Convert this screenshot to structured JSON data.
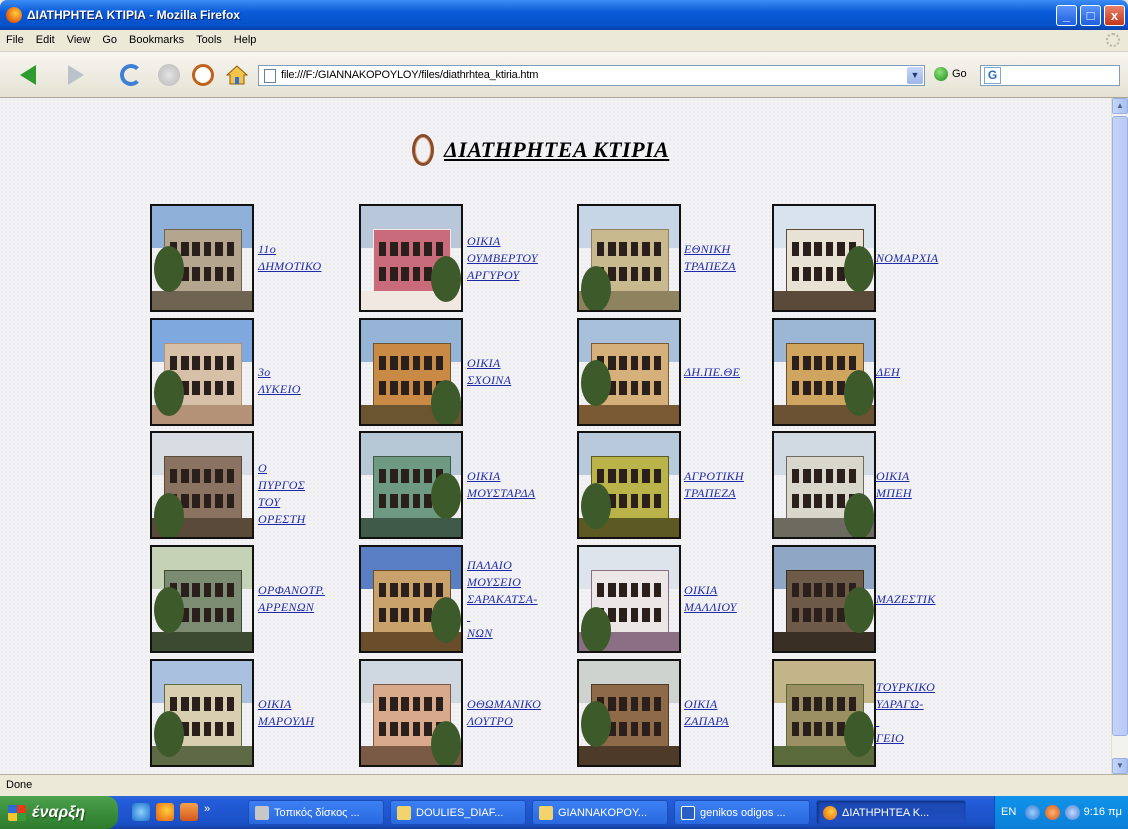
{
  "window": {
    "title": "ΔΙΑΤΗΡΗΤΕΑ ΚΤΙΡΙΑ - Mozilla Firefox",
    "minimize": "_",
    "maximize": "□",
    "close": "x"
  },
  "menu": {
    "items": [
      "File",
      "Edit",
      "View",
      "Go",
      "Bookmarks",
      "Tools",
      "Help"
    ]
  },
  "toolbar": {
    "url": "file:///F:/GIANNAKOPOYLOY/files/diathrhtea_ktiria.htm",
    "go_label": "Go",
    "search_engine_glyph": "G",
    "icons": [
      "back-icon",
      "forward-icon",
      "reload-icon",
      "stop-icon",
      "history-icon",
      "home-icon",
      "page-icon",
      "dropdown-icon",
      "go-icon",
      "google-icon"
    ]
  },
  "page": {
    "heading": "ΔΙΑΤΗΡΗΤΕΑ ΚΤΙΡΙΑ",
    "buildings": [
      [
        "11ο",
        "ΔΗΜΟΤΙΚΟ"
      ],
      [
        "ΟΙΚΙΑ",
        "ΟΥΜΒΕΡΤΟΥ",
        "ΑΡΓΥΡΟΥ"
      ],
      [
        "ΕΘΝΙΚΗ",
        "ΤΡΑΠΕΖΑ"
      ],
      [
        "ΝΟΜΑΡΧΙΑ"
      ],
      [
        "3ο ΛΥΚΕΙΟ"
      ],
      [
        "ΟΙΚΙΑ",
        "ΣΧΟΙΝΑ"
      ],
      [
        "ΔΗ.ΠΕ.ΘΕ"
      ],
      [
        "ΔΕΗ"
      ],
      [
        "Ο ΠΥΡΓΟΣ",
        "ΤΟΥ",
        "ΟΡΕΣΤΗ"
      ],
      [
        "ΟΙΚΙΑ",
        "ΜΟΥΣΤΑΡΔΑ"
      ],
      [
        "ΑΓΡΟΤΙΚΗ",
        "ΤΡΑΠΕΖΑ"
      ],
      [
        "ΟΙΚΙΑ",
        "ΜΠΕΗ"
      ],
      [
        "ΟΡΦΑΝΟΤΡ.",
        "ΑΡΡΕΝΩΝ"
      ],
      [
        "ΠΑΛΑΙΟ",
        "ΜΟΥΣΕΙΟ",
        "ΣΑΡΑΚΑΤΣΑ-",
        "",
        "ΝΩΝ"
      ],
      [
        "ΟΙΚΙΑ",
        "ΜΑΛΛΙΟΥ"
      ],
      [
        "ΜΑΖΕΣΤΙΚ"
      ],
      [
        "ΟΙΚΙΑ",
        "ΜΑΡΟΥΛΗ"
      ],
      [
        "ΟΘΩΜΑΝΙΚΟ",
        "ΛΟΥΤΡΟ"
      ],
      [
        "ΟΙΚΙΑ",
        "ΖΑΠΑΡΑ"
      ],
      [
        "ΤΟΥΡΚΙΚΟ",
        "ΥΔΡΑΓΩ-",
        "",
        "ΓΕΙΟ"
      ]
    ],
    "photo_colors": [
      {
        "sky": "#8fb0d8",
        "bld": "#b3a58e",
        "accent": "#6f6452"
      },
      {
        "sky": "#b9c7da",
        "bld": "#c96b7a",
        "accent": "#f1e8e2"
      },
      {
        "sky": "#c7d6e6",
        "bld": "#c9b98e",
        "accent": "#8f835f"
      },
      {
        "sky": "#d9e3ee",
        "bld": "#e8e2d4",
        "accent": "#5b4a3a"
      },
      {
        "sky": "#7fa8df",
        "bld": "#d7c0a8",
        "accent": "#b39277"
      },
      {
        "sky": "#96b4d6",
        "bld": "#c98a46",
        "accent": "#6b5530"
      },
      {
        "sky": "#a8c0da",
        "bld": "#d6b07a",
        "accent": "#7a5a35"
      },
      {
        "sky": "#9cb7d6",
        "bld": "#cfa560",
        "accent": "#6a5233"
      },
      {
        "sky": "#d8dde3",
        "bld": "#8a7461",
        "accent": "#5a4a3a"
      },
      {
        "sky": "#b6c7d6",
        "bld": "#6f9a82",
        "accent": "#3f5a48"
      },
      {
        "sky": "#b8c9dc",
        "bld": "#b9b34a",
        "accent": "#5c5a22"
      },
      {
        "sky": "#d1d9e2",
        "bld": "#d9d6cc",
        "accent": "#6d6a60"
      },
      {
        "sky": "#c5d2b5",
        "bld": "#7c8c72",
        "accent": "#3b4a30"
      },
      {
        "sky": "#5a7ec4",
        "bld": "#c8a26a",
        "accent": "#6a4d2a"
      },
      {
        "sky": "#dde4ec",
        "bld": "#ece6e6",
        "accent": "#8a6f85"
      },
      {
        "sky": "#8fa6c4",
        "bld": "#6d5a48",
        "accent": "#3a2f25"
      },
      {
        "sky": "#a9c1de",
        "bld": "#d7cfb0",
        "accent": "#5e6a45"
      },
      {
        "sky": "#cfd8e1",
        "bld": "#d8a98a",
        "accent": "#7a5a45"
      },
      {
        "sky": "#cfd3cf",
        "bld": "#8f6a48",
        "accent": "#4d3a28"
      },
      {
        "sky": "#c4b48a",
        "bld": "#9a8f62",
        "accent": "#5a6a3a"
      }
    ]
  },
  "status": {
    "text": "Done"
  },
  "taskbar": {
    "start_label": "έναρξη",
    "tasks": [
      "Τοπικός δίσκος ...",
      "DOULIES_DIAF...",
      "GIANNAKOPOY...",
      "genikos odigos ...",
      "ΔΙΑΤΗΡΗΤΕΑ Κ..."
    ],
    "language": "EN",
    "clock": "9:16 πμ",
    "overflow": "»"
  },
  "colors": {
    "link": "#1f2aa8",
    "titlebar": "#0a5bd8",
    "taskbar": "#245edb",
    "start": "#3a8d3a"
  }
}
